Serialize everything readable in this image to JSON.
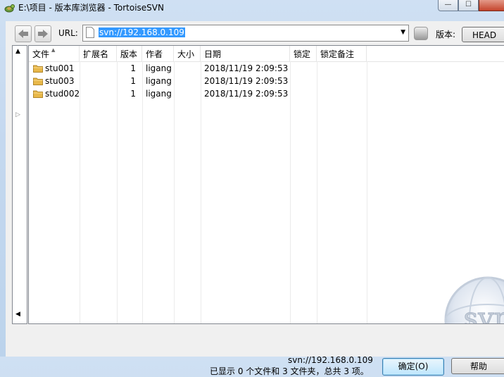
{
  "window": {
    "title": "E:\\项目 - 版本库浏览器 - TortoiseSVN",
    "minimize_glyph": "—",
    "maximize_glyph": "☐"
  },
  "toolbar": {
    "url_label": "URL:",
    "url_value": "svn://192.168.0.109",
    "dropdown_glyph": "▼",
    "revision_label": "版本:",
    "revision_value": "HEAD"
  },
  "tree": {
    "expand_up": "▲",
    "expand_right": "▷",
    "scroll_left": "◀"
  },
  "columns": {
    "file": "文件",
    "ext": "扩展名",
    "revision": "版本",
    "author": "作者",
    "size": "大小",
    "date": "日期",
    "lock": "锁定",
    "lock_comment": "锁定备注",
    "sort_glyph": "▲"
  },
  "rows": [
    {
      "name": "stu001",
      "ext": "",
      "revision": "1",
      "author": "ligang",
      "size": "",
      "date": "2018/11/19 2:09:53",
      "lock": "",
      "lock_comment": ""
    },
    {
      "name": "stu003",
      "ext": "",
      "revision": "1",
      "author": "ligang",
      "size": "",
      "date": "2018/11/19 2:09:53",
      "lock": "",
      "lock_comment": ""
    },
    {
      "name": "stud002",
      "ext": "",
      "revision": "1",
      "author": "ligang",
      "size": "",
      "date": "2018/11/19 2:09:53",
      "lock": "",
      "lock_comment": ""
    }
  ],
  "logo": {
    "text": "svn"
  },
  "status": {
    "url": "svn://192.168.0.109",
    "summary": "已显示 0 个文件和 3 文件夹，总共 3 项。"
  },
  "buttons": {
    "ok": "确定(O)",
    "help": "帮助"
  },
  "colors": {
    "selection": "#3399ff",
    "folder": "#e8b84a",
    "ok_border": "#3c7fb1"
  }
}
